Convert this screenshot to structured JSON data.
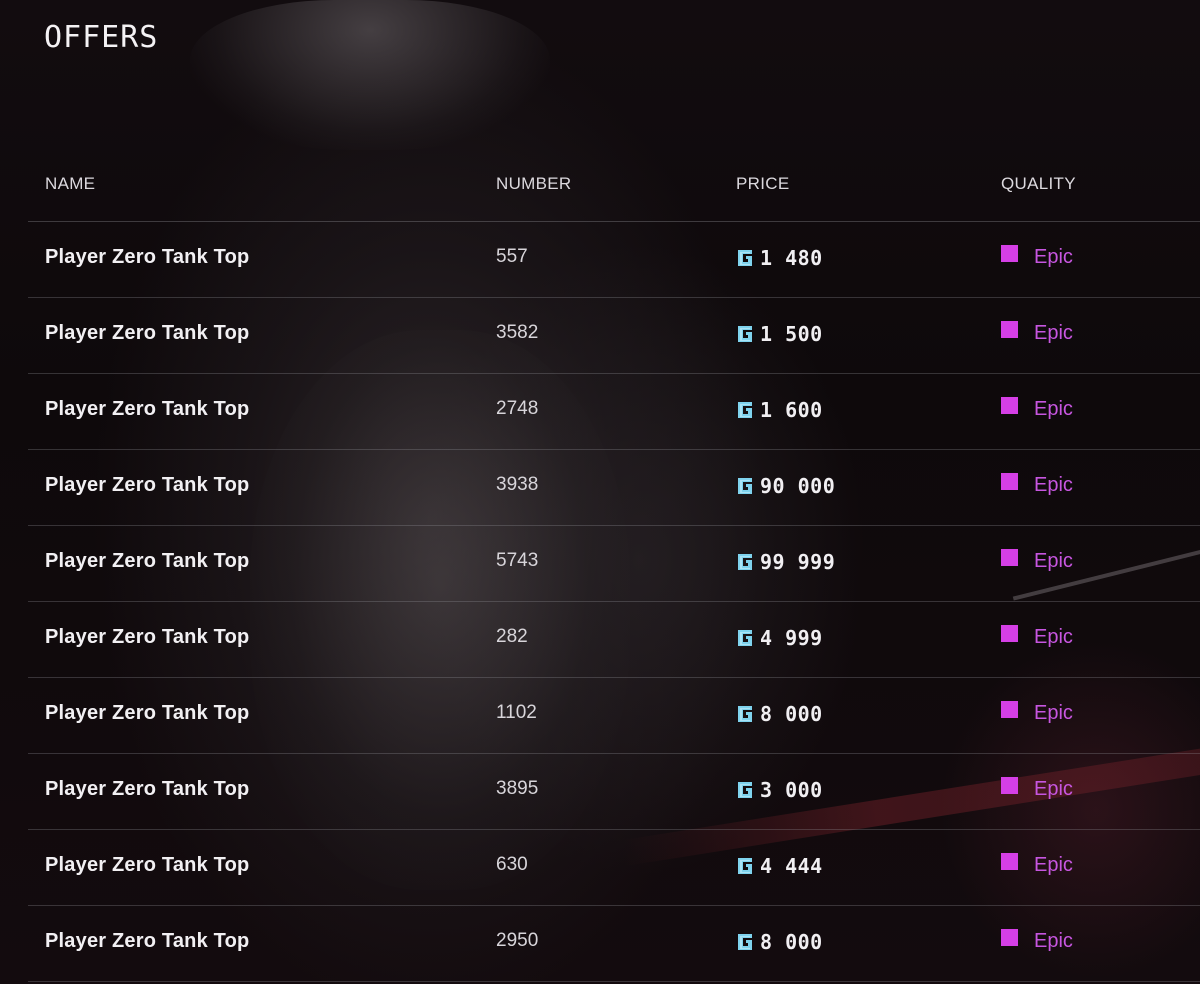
{
  "header": {
    "title": "OFFERS"
  },
  "table": {
    "columns": {
      "name": "NAME",
      "number": "NUMBER",
      "price": "PRICE",
      "quality": "QUALITY"
    },
    "rows": [
      {
        "name": "Player Zero Tank Top",
        "number": "557",
        "price": "1 480",
        "quality": "Epic"
      },
      {
        "name": "Player Zero Tank Top",
        "number": "3582",
        "price": "1 500",
        "quality": "Epic"
      },
      {
        "name": "Player Zero Tank Top",
        "number": "2748",
        "price": "1 600",
        "quality": "Epic"
      },
      {
        "name": "Player Zero Tank Top",
        "number": "3938",
        "price": "90 000",
        "quality": "Epic"
      },
      {
        "name": "Player Zero Tank Top",
        "number": "5743",
        "price": "99 999",
        "quality": "Epic"
      },
      {
        "name": "Player Zero Tank Top",
        "number": "282",
        "price": "4 999",
        "quality": "Epic"
      },
      {
        "name": "Player Zero Tank Top",
        "number": "1102",
        "price": "8 000",
        "quality": "Epic"
      },
      {
        "name": "Player Zero Tank Top",
        "number": "3895",
        "price": "3 000",
        "quality": "Epic"
      },
      {
        "name": "Player Zero Tank Top",
        "number": "630",
        "price": "4 444",
        "quality": "Epic"
      },
      {
        "name": "Player Zero Tank Top",
        "number": "2950",
        "price": "8 000",
        "quality": "Epic"
      }
    ]
  },
  "icons": {
    "currency": "currency-coin-icon",
    "quality": "quality-swatch"
  },
  "colors": {
    "epic": "#d53fe6",
    "epic_text": "#c756e0",
    "coin": "#7fd3ee"
  }
}
